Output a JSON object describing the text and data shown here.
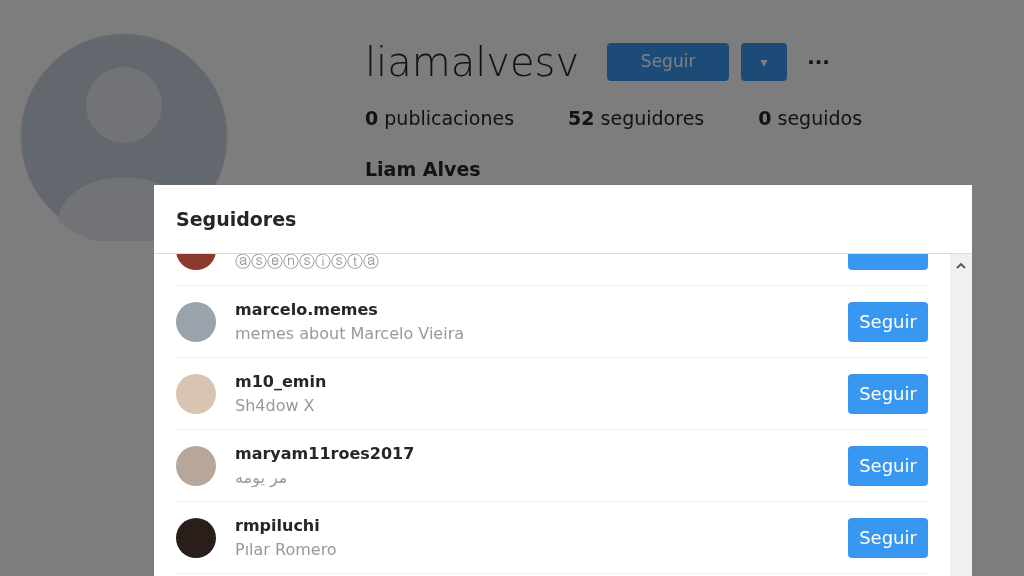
{
  "profile": {
    "username": "liamalvesv",
    "follow_button": "Seguir",
    "dropdown_button": "▾",
    "more_button": "···",
    "stats": [
      {
        "count": "0",
        "label": "publicaciones"
      },
      {
        "count": "52",
        "label": "seguidores"
      },
      {
        "count": "0",
        "label": "seguidos"
      }
    ],
    "full_name": "Liam Alves"
  },
  "modal": {
    "title": "Seguidores",
    "followers": [
      {
        "subtitle": "ⓐⓢⓔⓝⓢⓘⓢⓣⓐ"
      },
      {
        "username": "marcelo.memes",
        "subtitle": "memes about Marcelo Vieira",
        "button": "Seguir"
      },
      {
        "username": "m10_emin",
        "subtitle": "Sh4dow X",
        "button": "Seguir"
      },
      {
        "username": "maryam11roes2017",
        "subtitle": "مر يومه",
        "button": "Seguir"
      },
      {
        "username": "rmpiluchi",
        "subtitle": "Pılar Romero",
        "button": "Seguir"
      }
    ]
  }
}
